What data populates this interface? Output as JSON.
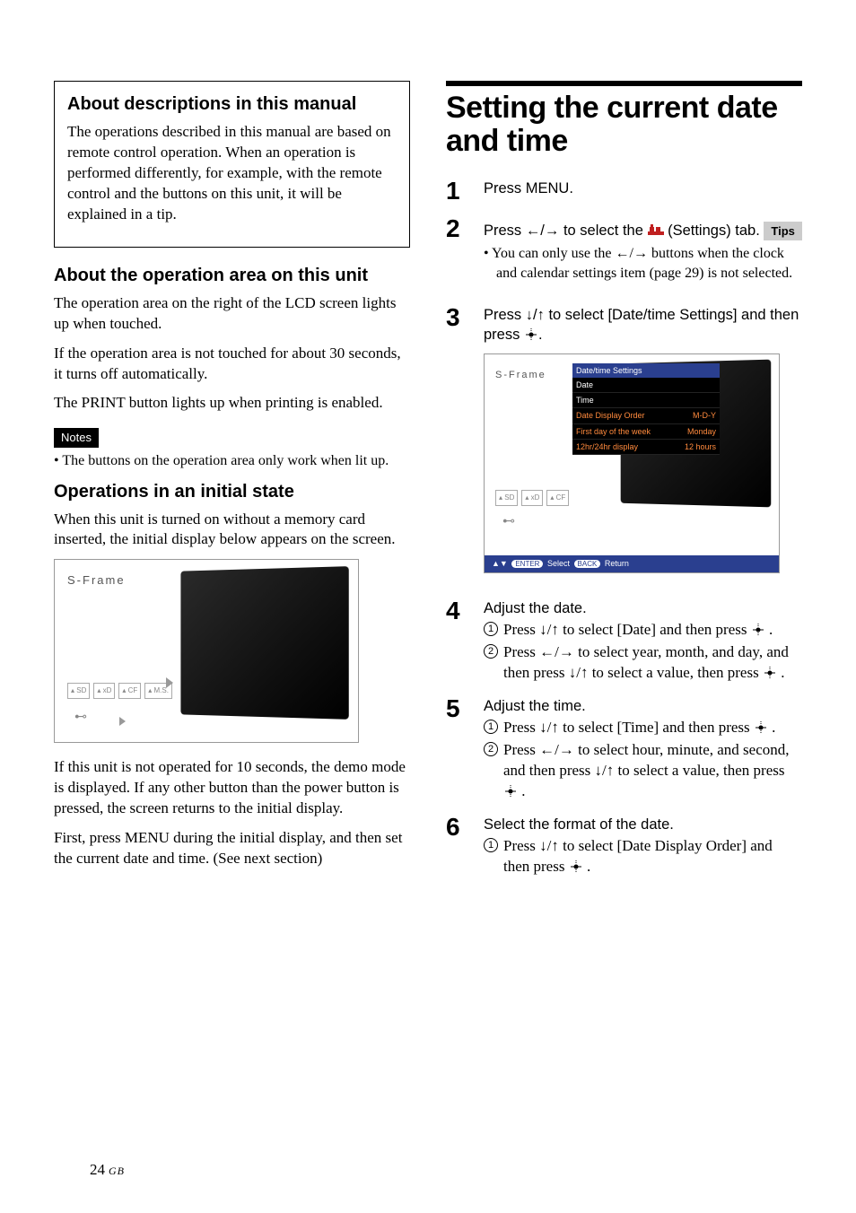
{
  "left": {
    "box1_heading": "About descriptions in this manual",
    "box1_body": "The operations described in this manual are based on remote control operation. When an operation is performed differently, for example, with the remote control and the buttons on this unit, it will be explained in a tip.",
    "h2_operation": "About the operation area on this unit",
    "p_op1": "The operation area on the right of the LCD screen lights up when touched.",
    "p_op2": "If the operation area is not touched for about 30 seconds, it turns off automatically.",
    "p_op3": "The PRINT button lights up when printing is enabled.",
    "notes_label": "Notes",
    "note1": "The buttons on the operation area only work when lit up.",
    "h2_initial": "Operations in an initial state",
    "p_init1": "When this unit is turned on without a memory card inserted, the initial display below appears on the screen.",
    "p_init2": "If this unit is not operated for 10 seconds, the demo mode is displayed. If any other button than the power button is pressed, the screen returns to the initial display.",
    "p_init3": "First, press MENU during the initial display, and then set the current date and time. (See next section)",
    "sframe": "S-Frame",
    "slot_sd": "▴\nSD",
    "slot_xd": "▴\nxD",
    "slot_cf": "▴\nCF",
    "slot_ms": "▴\nM.S."
  },
  "right": {
    "main_title": "Setting the current date and time",
    "step1": "Press MENU.",
    "step2_a": "Press ",
    "step2_b": " to select the ",
    "step2_c": " (Settings) tab.",
    "arrows_lr": "←/→",
    "arrows_ud": "↓/↑",
    "tips_label": "Tips",
    "tip1_a": "You can only use the ",
    "tip1_b": " buttons when the clock and calendar settings item (page 29) is not selected.",
    "step3_a": "Press ",
    "step3_b": " to select [Date/time Settings] and then press ",
    "step3_c": ".",
    "menu": {
      "title": "Date/time Settings",
      "r1": "Date",
      "r2": "Time",
      "r3l": "Date Display Order",
      "r3r": "M-D-Y",
      "r4l": "First day of the week",
      "r4r": "Monday",
      "r5l": "12hr/24hr display",
      "r5r": "12 hours",
      "footer_select": "Select",
      "footer_return": "Return",
      "footer_enter": "ENTER",
      "footer_back": "BACK",
      "slot_sd": "▴\nSD",
      "slot_xd": "▴\nxD",
      "slot_cf": "▴\nCF"
    },
    "step4_head": "Adjust the date.",
    "step4_s1_a": "Press ",
    "step4_s1_b": " to select [Date] and then press ",
    "step4_s2_a": "Press ",
    "step4_s2_b": " to select year, month, and day, and then press ",
    "step4_s2_c": " to select a value, then press ",
    "step5_head": "Adjust the time.",
    "step5_s1_a": "Press ",
    "step5_s1_b": " to select [Time] and then press ",
    "step5_s2_a": "Press ",
    "step5_s2_b": " to select hour, minute, and second, and then press ",
    "step5_s2_c": " to select a value, then press ",
    "step6_head": "Select the format of the date.",
    "step6_s1_a": "Press ",
    "step6_s1_b": " to select [Date Display Order] and then press ",
    "dot": "."
  },
  "page": {
    "num": "24",
    "region": "GB"
  }
}
